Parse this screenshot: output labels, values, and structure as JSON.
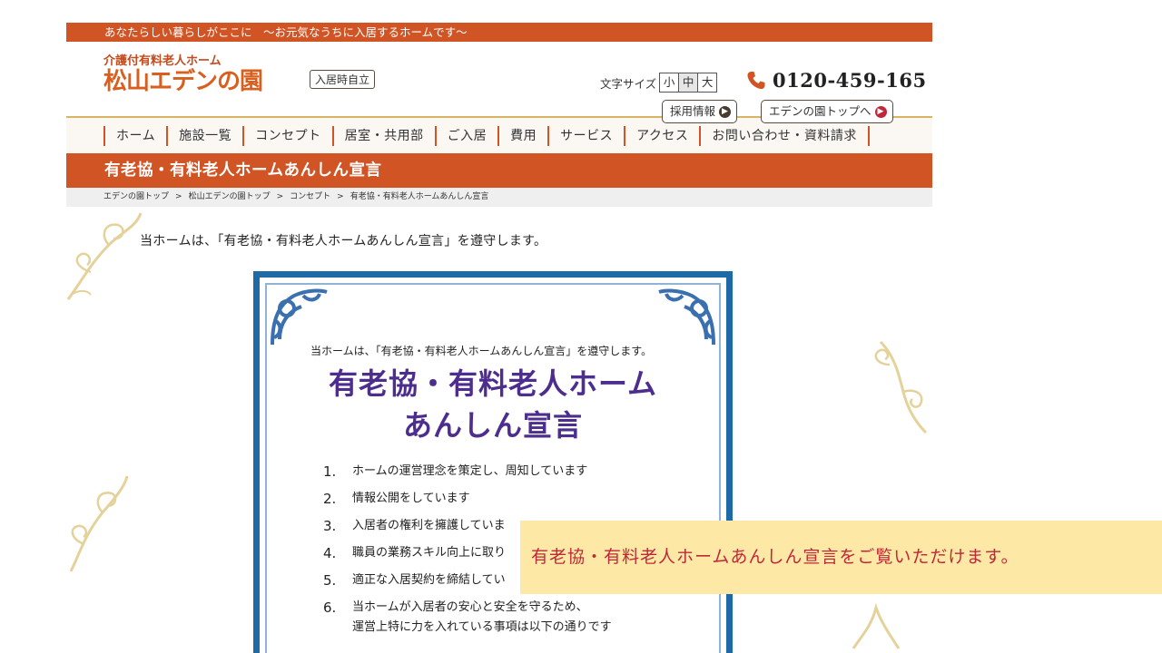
{
  "topbar": {
    "text": "あなたらしい暮らしがここに　～お元気なうちに入居するホームです～"
  },
  "header": {
    "logo_sub": "介護付有料老人ホーム",
    "logo_main": "松山エデンの園",
    "badge": "入居時自立",
    "fontsize_label": "文字サイズ",
    "fontsize_options": [
      "小",
      "中",
      "大"
    ],
    "phone": "0120-459-165",
    "recruit_label": "採用情報",
    "top_label": "エデンの園トップへ"
  },
  "nav": [
    "ホーム",
    "施設一覧",
    "コンセプト",
    "居室・共用部",
    "ご入居",
    "費用",
    "サービス",
    "アクセス",
    "お問い合わせ・資料請求"
  ],
  "page_title": "有老協・有料老人ホームあんしん宣言",
  "breadcrumb": [
    "エデンの園トップ",
    "松山エデンの園トップ",
    "コンセプト",
    "有老協・有料老人ホームあんしん宣言"
  ],
  "intro": "当ホームは、「有老協・有料老人ホームあんしん宣言」を遵守します。",
  "document": {
    "intro": "当ホームは、「有老協・有料老人ホームあんしん宣言」を遵守します。",
    "title_line1": "有老協・有料老人ホーム",
    "title_line2": "あんしん宣言",
    "items": [
      {
        "num": "1.",
        "text": "ホームの運営理念を策定し、周知しています"
      },
      {
        "num": "2.",
        "text": "情報公開をしています"
      },
      {
        "num": "3.",
        "text": "入居者の権利を擁護していま"
      },
      {
        "num": "4.",
        "text": "職員の業務スキル向上に取り"
      },
      {
        "num": "5.",
        "text": "適正な入居契約を締結してい"
      },
      {
        "num": "6.",
        "text": "当ホームが入居者の安心と安全を守るため、",
        "text2": "運営上特に力を入れている事項は以下の通りです"
      }
    ]
  },
  "toast": {
    "text": "有老協・有料老人ホームあんしん宣言をご覧いただけます。"
  },
  "colors": {
    "brand": "#d15425",
    "doc_border": "#1e6aa6",
    "doc_title": "#4d2e8e",
    "toast_bg": "#fde9a5",
    "toast_text": "#c0283a"
  }
}
